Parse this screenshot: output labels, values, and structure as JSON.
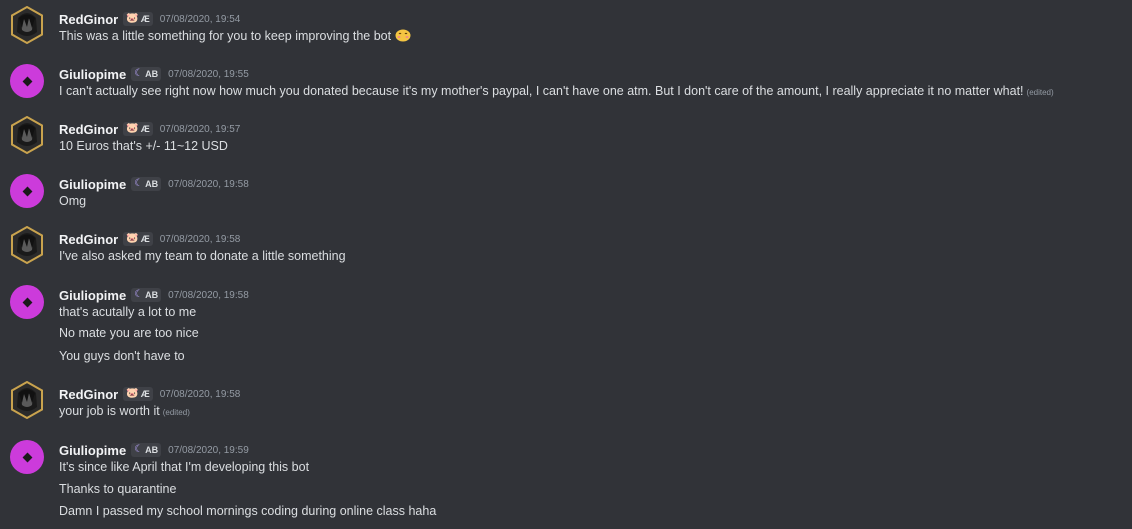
{
  "users": {
    "redginor": {
      "name": "RedGinor",
      "tag_text": "Æ",
      "tag_icon": "pig-badge-icon"
    },
    "giulio": {
      "name": "Giuliopime",
      "tag_text": "AB",
      "tag_icon": "moon-badge-icon"
    }
  },
  "messages": [
    {
      "author": "RedGinor",
      "tag": "Æ",
      "timestamp": "07/08/2020, 19:54",
      "lines": [
        {
          "text": "This was a little something for you to keep improving the bot",
          "emoji": "blush-face-emoji"
        }
      ]
    },
    {
      "author": "Giuliopime",
      "tag": "AB",
      "timestamp": "07/08/2020, 19:55",
      "lines": [
        {
          "text": "I can't actually see right now how much you donated because it's my mother's paypal, I can't have one atm. But I don't care of the amount, I really appreciate it no matter what!",
          "edited": "(edited)"
        }
      ]
    },
    {
      "author": "RedGinor",
      "tag": "Æ",
      "timestamp": "07/08/2020, 19:57",
      "lines": [
        {
          "text": "10 Euros that's +/-  11~12 USD"
        }
      ]
    },
    {
      "author": "Giuliopime",
      "tag": "AB",
      "timestamp": "07/08/2020, 19:58",
      "lines": [
        {
          "text": "Omg"
        }
      ]
    },
    {
      "author": "RedGinor",
      "tag": "Æ",
      "timestamp": "07/08/2020, 19:58",
      "lines": [
        {
          "text": "I've also asked my team to donate a little something"
        }
      ]
    },
    {
      "author": "Giuliopime",
      "tag": "AB",
      "timestamp": "07/08/2020, 19:58",
      "lines": [
        {
          "text": "that's acutally a lot to me"
        },
        {
          "text": "No mate you are too nice"
        },
        {
          "text": "You guys don't have to"
        }
      ]
    },
    {
      "author": "RedGinor",
      "tag": "Æ",
      "timestamp": "07/08/2020, 19:58",
      "lines": [
        {
          "text": "your job is worth it",
          "edited": "(edited)"
        }
      ]
    },
    {
      "author": "Giuliopime",
      "tag": "AB",
      "timestamp": "07/08/2020, 19:59",
      "lines": [
        {
          "text": "It's since like April that I'm developing this bot"
        },
        {
          "text": "Thanks to quarantine"
        },
        {
          "text": "Damn I passed my school mornings coding during online class haha"
        }
      ]
    }
  ],
  "colors": {
    "background": "#313338",
    "giulio_avatar": "#cc3bdb",
    "redginor_avatar_border": "#c9a34e"
  }
}
